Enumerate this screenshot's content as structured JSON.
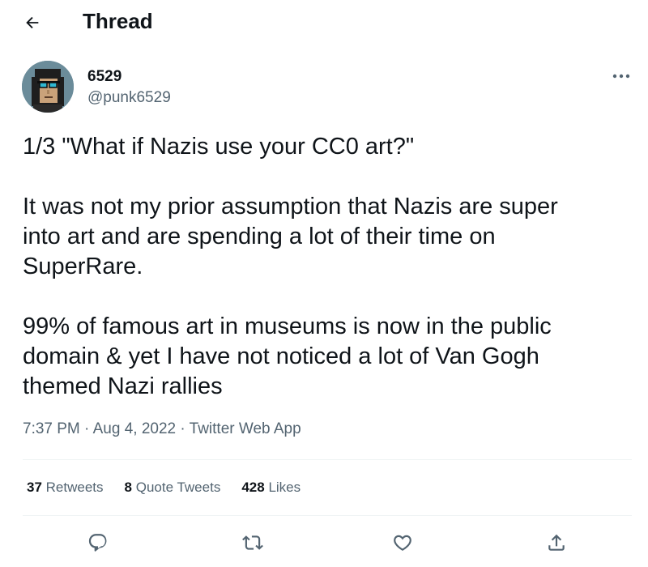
{
  "header": {
    "title": "Thread",
    "back_icon": "arrow-left-icon"
  },
  "author": {
    "name": "6529",
    "handle": "@punk6529",
    "avatar_icon": "punk-avatar"
  },
  "tweet": {
    "text": "1/3 \"What if Nazis use your CC0 art?\"\n\nIt was not my prior assumption that Nazis are super\ninto art and are spending a lot of their time on\nSuperRare.\n\n99% of famous art in museums is now in the public\ndomain & yet I have not noticed a lot of Van Gogh\nthemed Nazi rallies",
    "time": "7:37 PM",
    "separator": "·",
    "date": "Aug 4, 2022",
    "source": "Twitter Web App"
  },
  "stats": {
    "retweets_count": "37",
    "retweets_label": "Retweets",
    "quotes_count": "8",
    "quotes_label": "Quote Tweets",
    "likes_count": "428",
    "likes_label": "Likes"
  },
  "actions": [
    "reply-icon",
    "retweet-icon",
    "like-icon",
    "share-icon"
  ],
  "colors": {
    "text": "#0f1419",
    "secondary": "#536471",
    "divider": "#eff3f4"
  }
}
